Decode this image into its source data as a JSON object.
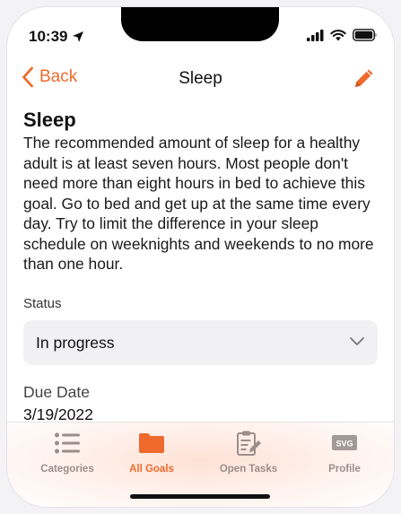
{
  "status_bar": {
    "time": "10:39"
  },
  "nav": {
    "back_label": "Back",
    "title": "Sleep"
  },
  "goal": {
    "title": "Sleep",
    "description": "The recommended amount of sleep for a healthy adult is at least seven hours. Most people don't need more than eight hours in bed to achieve this goal. Go to bed and get up at the same time every day. Try to limit the difference in your sleep schedule on weeknights and weekends to no more than one hour.",
    "status_label": "Status",
    "status_value": "In progress",
    "due_label": "Due Date",
    "due_value": "3/19/2022"
  },
  "tabs": [
    {
      "label": "Categories",
      "icon": "list-icon",
      "active": false
    },
    {
      "label": "All Goals",
      "icon": "folder-icon",
      "active": true
    },
    {
      "label": "Open Tasks",
      "icon": "clipboard-icon",
      "active": false
    },
    {
      "label": "Profile",
      "icon": "svg-icon",
      "icon_text": "SVG",
      "active": false
    }
  ],
  "colors": {
    "accent": "#ee6a2d",
    "inactive": "#9b8e8a"
  }
}
